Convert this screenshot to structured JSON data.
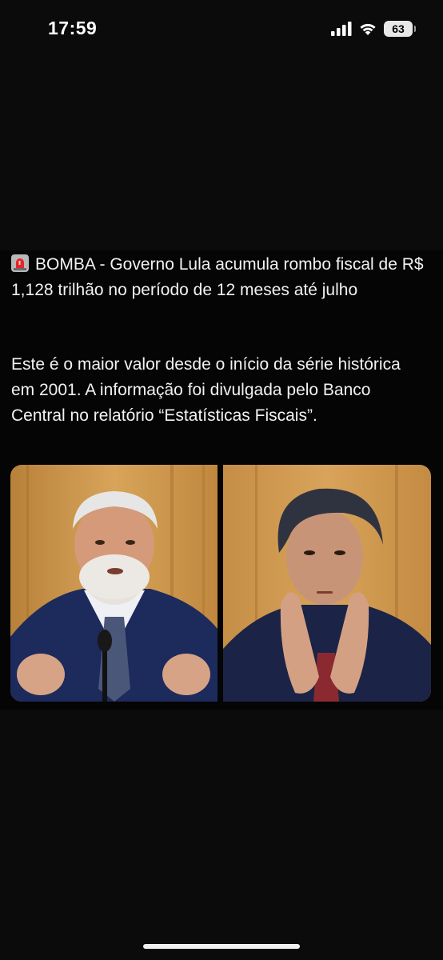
{
  "status_bar": {
    "time": "17:59",
    "battery": "63",
    "icons": [
      "signal-icon",
      "wifi-icon",
      "battery-icon"
    ]
  },
  "post": {
    "emoji": "siren-icon",
    "headline": "BOMBA - Governo Lula acumula rombo fiscal de R$ 1,128 trilhão no período de 12 meses até julho",
    "body": "Este é o maior valor desde o início da série histórica em 2001. A informação foi divulgada pelo Banco Central no relatório “Estatísticas Fiscais”."
  },
  "colors": {
    "background": "#0b0b0b",
    "post_background": "#050505",
    "text": "#f2f2f2",
    "siren_red": "#e3262b"
  }
}
